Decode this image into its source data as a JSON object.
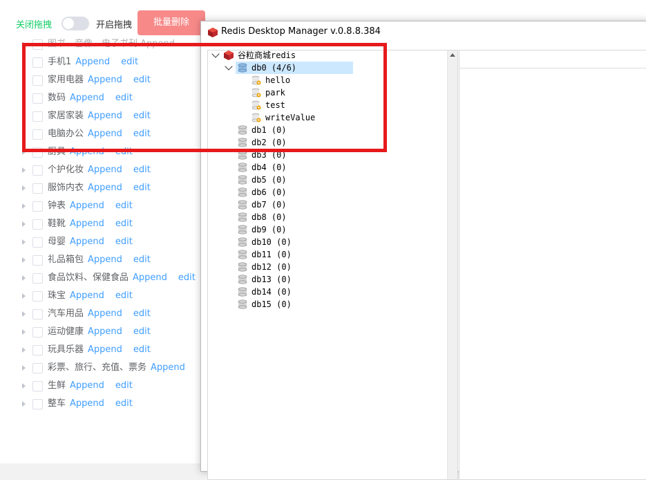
{
  "toolbar": {
    "close_drag_label": "关闭拖拽",
    "open_drag_label": "开启拖拽",
    "batch_delete_label": "批量删除"
  },
  "category_tree": {
    "top_partial": "图书、音像、电子书刊 Append",
    "items": [
      {
        "name": "手机1",
        "append": "Append",
        "edit": "edit"
      },
      {
        "name": "家用电器",
        "append": "Append",
        "edit": "edit"
      },
      {
        "name": "数码",
        "append": "Append",
        "edit": "edit"
      },
      {
        "name": "家居家装",
        "append": "Append",
        "edit": "edit"
      },
      {
        "name": "电脑办公",
        "append": "Append",
        "edit": "edit"
      },
      {
        "name": "厨具",
        "append": "Append",
        "edit": "edit"
      },
      {
        "name": "个护化妆",
        "append": "Append",
        "edit": "edit"
      },
      {
        "name": "服饰内衣",
        "append": "Append",
        "edit": "edit"
      },
      {
        "name": "钟表",
        "append": "Append",
        "edit": "edit"
      },
      {
        "name": "鞋靴",
        "append": "Append",
        "edit": "edit"
      },
      {
        "name": "母婴",
        "append": "Append",
        "edit": "edit"
      },
      {
        "name": "礼品箱包",
        "append": "Append",
        "edit": "edit"
      },
      {
        "name": "食品饮料、保健食品",
        "append": "Append",
        "edit": "edit"
      },
      {
        "name": "珠宝",
        "append": "Append",
        "edit": "edit"
      },
      {
        "name": "汽车用品",
        "append": "Append",
        "edit": "edit"
      },
      {
        "name": "运动健康",
        "append": "Append",
        "edit": "edit"
      },
      {
        "name": "玩具乐器",
        "append": "Append",
        "edit": "edit"
      },
      {
        "name": "彩票、旅行、充值、票务",
        "append": "Append",
        "edit": ""
      },
      {
        "name": "生鲜",
        "append": "Append",
        "edit": "edit"
      },
      {
        "name": "整车",
        "append": "Append",
        "edit": "edit"
      }
    ]
  },
  "rdm": {
    "window_title": "Redis Desktop Manager v.0.8.8.384",
    "connection": "谷粒商城redis",
    "db0": {
      "label": "db0  (4/6)",
      "keys": [
        "hello",
        "park",
        "test",
        "writeValue"
      ]
    },
    "databases": [
      "db1  (0)",
      "db2  (0)",
      "db3  (0)",
      "db4  (0)",
      "db5  (0)",
      "db6  (0)",
      "db7  (0)",
      "db8  (0)",
      "db9  (0)",
      "db10 (0)",
      "db11 (0)",
      "db12 (0)",
      "db13 (0)",
      "db14 (0)",
      "db15 (0)"
    ]
  },
  "colors": {
    "accent_green": "#13ce66",
    "link_blue": "#409eff",
    "danger_button": "#f78989",
    "annotation_red": "#e6191b",
    "selection": "#cce8ff"
  }
}
